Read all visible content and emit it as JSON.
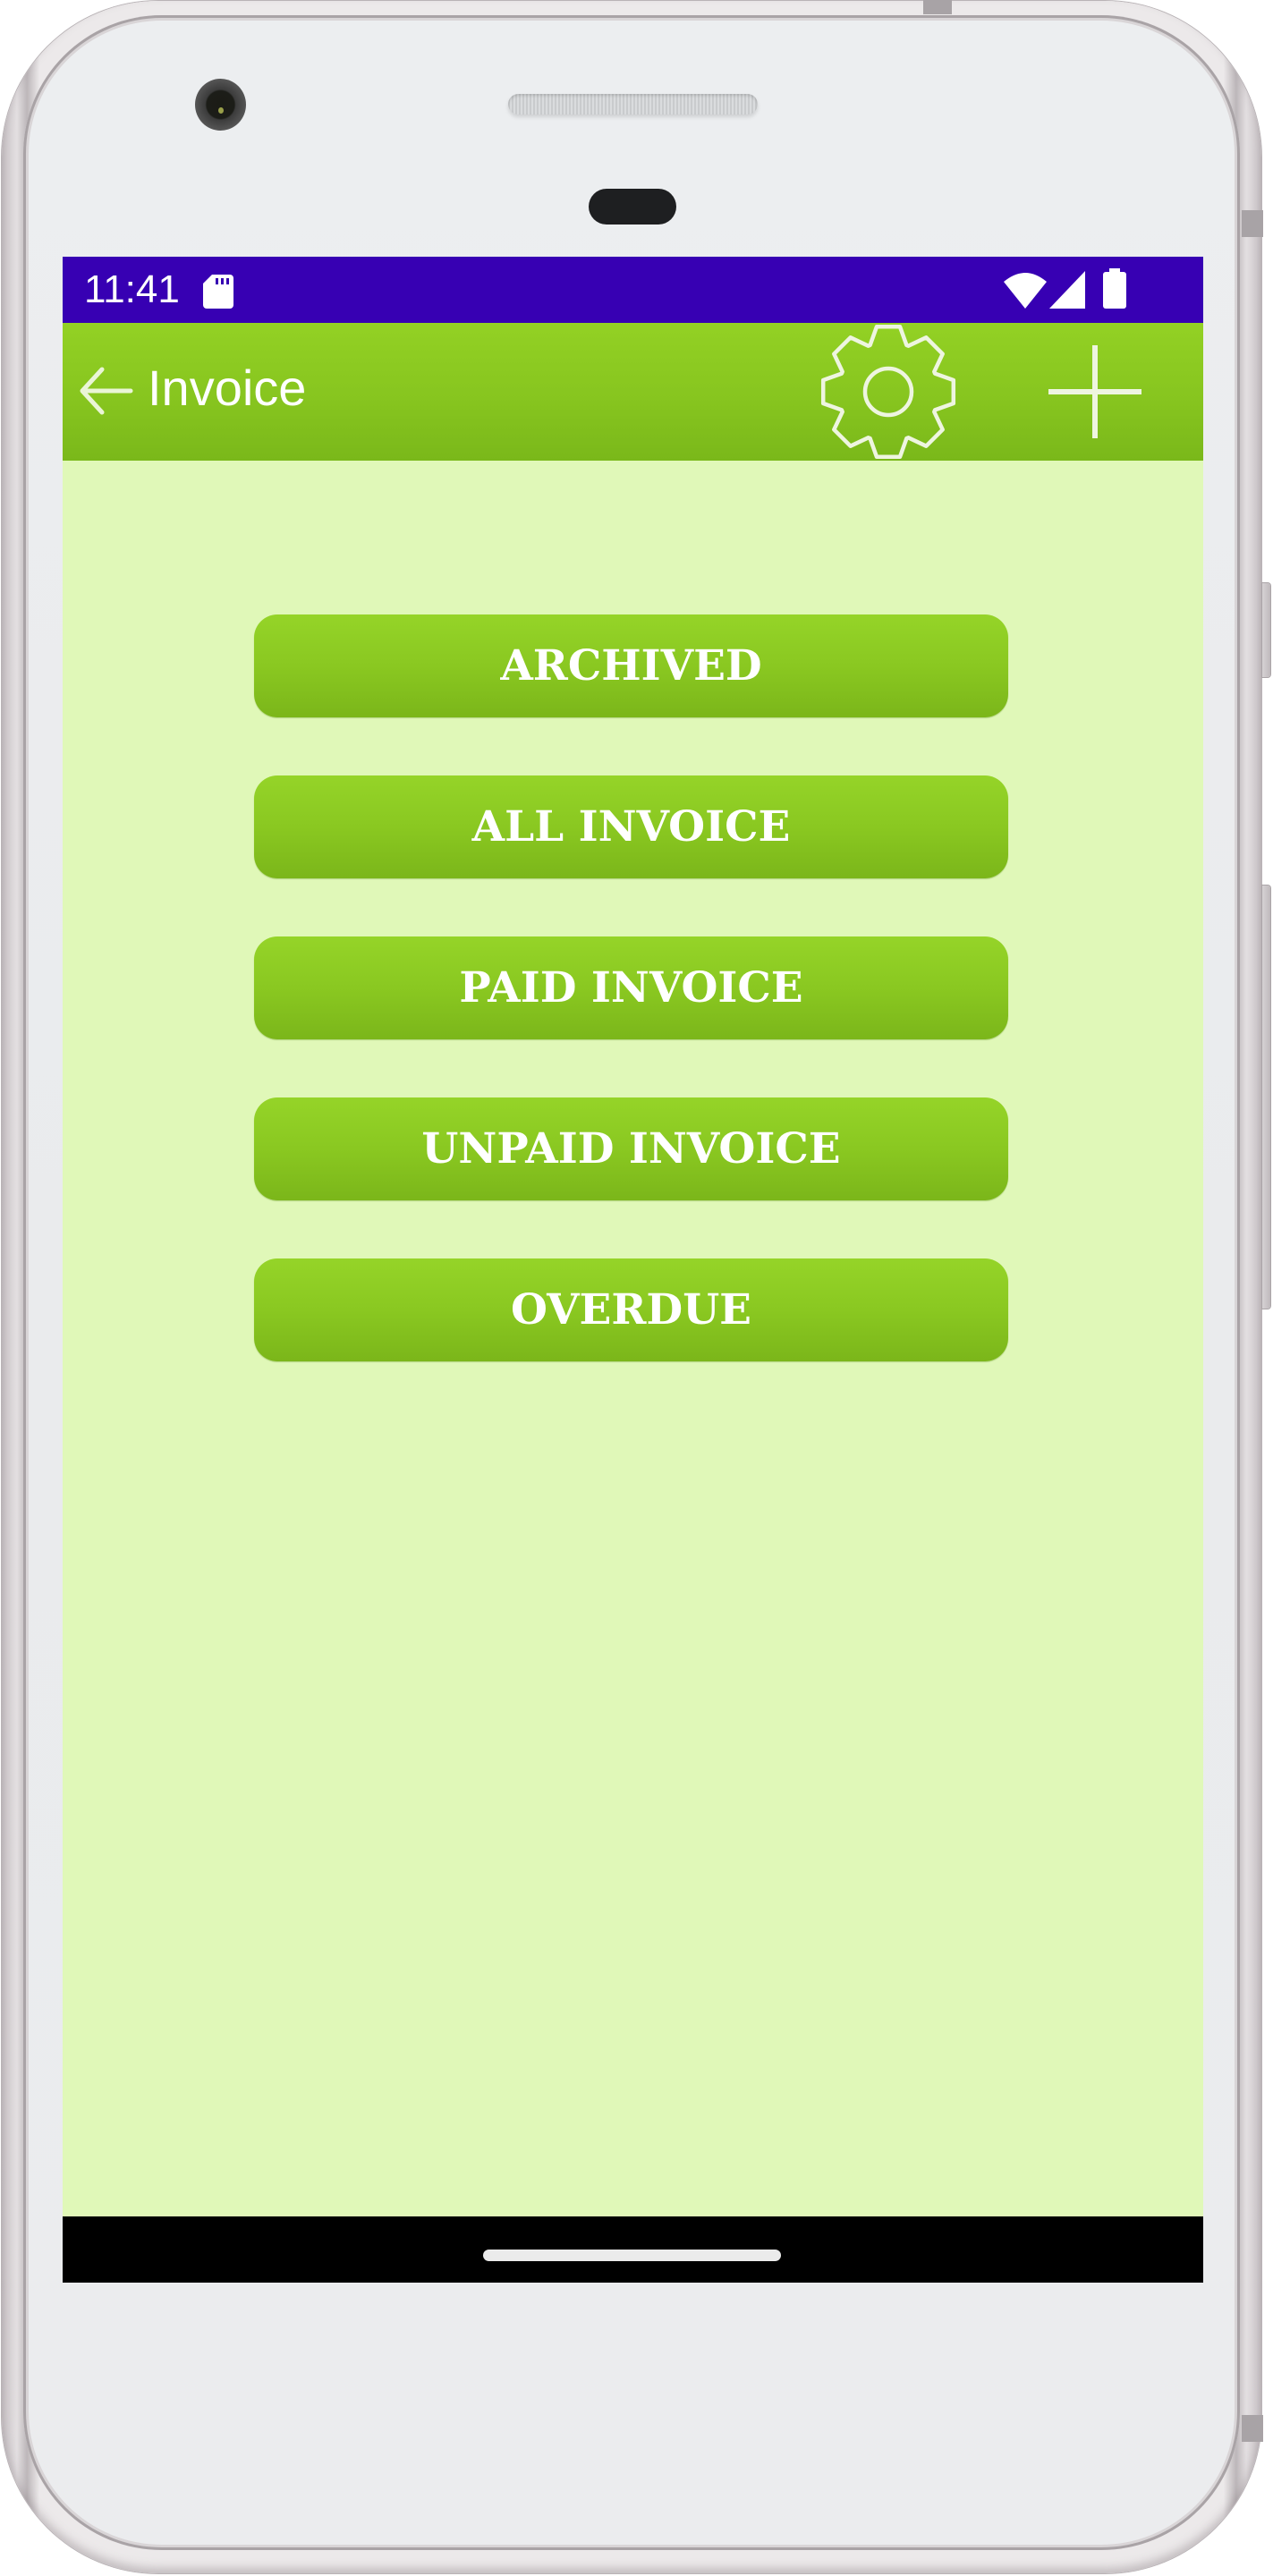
{
  "status_bar": {
    "time": "11:41",
    "icons": [
      "sd-card-icon",
      "wifi-icon",
      "signal-icon",
      "battery-icon"
    ],
    "background_color": "#3700b3"
  },
  "app_bar": {
    "back_icon": "arrow-left-icon",
    "title": "Invoice",
    "actions": [
      {
        "name": "settings",
        "icon": "gear-icon"
      },
      {
        "name": "add",
        "icon": "plus-icon"
      }
    ],
    "background_color": "#8bc820"
  },
  "menu": {
    "buttons": [
      {
        "id": "archived",
        "label": "ARCHIVED"
      },
      {
        "id": "all-invoice",
        "label": "ALL INVOICE"
      },
      {
        "id": "paid-invoice",
        "label": "PAID INVOICE"
      },
      {
        "id": "unpaid-invoice",
        "label": "UNPAID INVOICE"
      },
      {
        "id": "overdue",
        "label": "OVERDUE"
      }
    ]
  },
  "theme": {
    "screen_background": "#e0f8b8",
    "button_color": "#8ac821",
    "button_text_color": "#ffffff"
  },
  "nav_bar": {
    "home_indicator": "home-pill"
  }
}
